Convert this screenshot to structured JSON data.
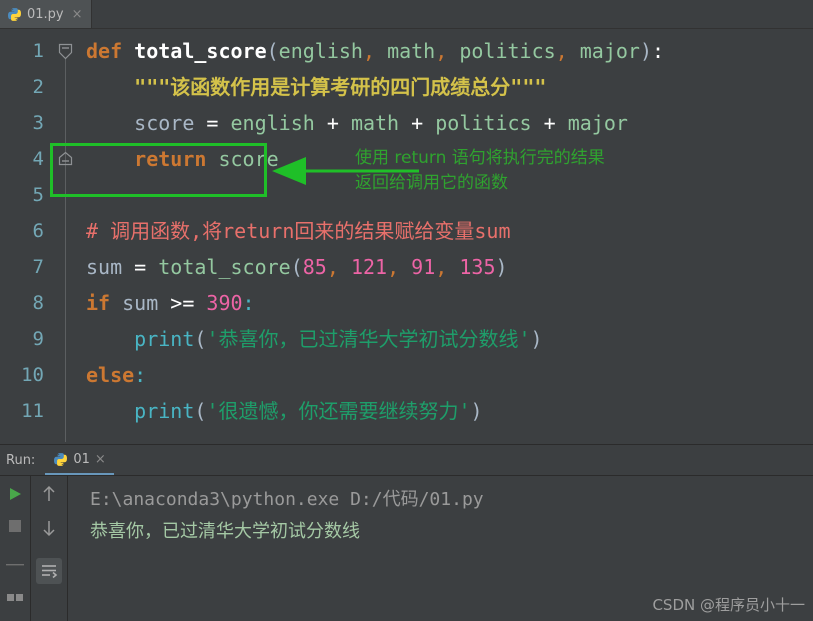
{
  "editor": {
    "tab": {
      "label": "01.py",
      "icon": "python-file-icon",
      "close": "×"
    },
    "line_numbers": [
      "1",
      "2",
      "3",
      "4",
      "5",
      "6",
      "7",
      "8",
      "9",
      "10",
      "11"
    ],
    "lines": [
      {
        "n": 1,
        "tokens": [
          {
            "t": "def ",
            "c": "kw"
          },
          {
            "t": "total_score",
            "c": "fn"
          },
          {
            "t": "(",
            "c": "punct"
          },
          {
            "t": "english",
            "c": "param"
          },
          {
            "t": ", ",
            "c": "comma"
          },
          {
            "t": "math",
            "c": "param"
          },
          {
            "t": ", ",
            "c": "comma"
          },
          {
            "t": "politics",
            "c": "param"
          },
          {
            "t": ", ",
            "c": "comma"
          },
          {
            "t": "major",
            "c": "param"
          },
          {
            "t": ")",
            "c": "punct"
          },
          {
            "t": ":",
            "c": "op"
          }
        ]
      },
      {
        "n": 2,
        "tokens": [
          {
            "t": "    \"\"\"该函数作用是计算考研的四门成绩总分\"\"\"",
            "c": "doc"
          }
        ]
      },
      {
        "n": 3,
        "tokens": [
          {
            "t": "    score ",
            "c": "var"
          },
          {
            "t": "= ",
            "c": "op"
          },
          {
            "t": "english ",
            "c": "param"
          },
          {
            "t": "+ ",
            "c": "op"
          },
          {
            "t": "math ",
            "c": "param"
          },
          {
            "t": "+ ",
            "c": "op"
          },
          {
            "t": "politics ",
            "c": "param"
          },
          {
            "t": "+ ",
            "c": "op"
          },
          {
            "t": "major",
            "c": "param"
          }
        ]
      },
      {
        "n": 4,
        "tokens": [
          {
            "t": "    ",
            "c": "var"
          },
          {
            "t": "return ",
            "c": "kw"
          },
          {
            "t": "score",
            "c": "param"
          }
        ]
      },
      {
        "n": 5,
        "tokens": []
      },
      {
        "n": 6,
        "tokens": [
          {
            "t": "# 调用函数,将return回来的结果赋给变量sum",
            "c": "comment"
          }
        ]
      },
      {
        "n": 7,
        "tokens": [
          {
            "t": "sum ",
            "c": "var"
          },
          {
            "t": "= ",
            "c": "op"
          },
          {
            "t": "total_score",
            "c": "param"
          },
          {
            "t": "(",
            "c": "punct"
          },
          {
            "t": "85",
            "c": "num"
          },
          {
            "t": ", ",
            "c": "comma"
          },
          {
            "t": "121",
            "c": "num"
          },
          {
            "t": ", ",
            "c": "comma"
          },
          {
            "t": "91",
            "c": "num"
          },
          {
            "t": ", ",
            "c": "comma"
          },
          {
            "t": "135",
            "c": "num"
          },
          {
            "t": ")",
            "c": "punct"
          }
        ]
      },
      {
        "n": 8,
        "tokens": [
          {
            "t": "if ",
            "c": "kw"
          },
          {
            "t": "sum ",
            "c": "var"
          },
          {
            "t": ">= ",
            "c": "op"
          },
          {
            "t": "390",
            "c": "num"
          },
          {
            "t": ":",
            "c": "builtin"
          }
        ]
      },
      {
        "n": 9,
        "tokens": [
          {
            "t": "    ",
            "c": "var"
          },
          {
            "t": "print",
            "c": "builtin"
          },
          {
            "t": "(",
            "c": "punct"
          },
          {
            "t": "'恭喜你，已过清华大学初试分数线'",
            "c": "str"
          },
          {
            "t": ")",
            "c": "punct"
          }
        ]
      },
      {
        "n": 10,
        "tokens": [
          {
            "t": "else",
            "c": "kw"
          },
          {
            "t": ":",
            "c": "builtin"
          }
        ]
      },
      {
        "n": 11,
        "tokens": [
          {
            "t": "    ",
            "c": "var"
          },
          {
            "t": "print",
            "c": "builtin"
          },
          {
            "t": "(",
            "c": "punct"
          },
          {
            "t": "'很遗憾，你还需要继续努力'",
            "c": "str"
          },
          {
            "t": ")",
            "c": "punct"
          }
        ]
      }
    ]
  },
  "annotation": {
    "color": "#1fbf28",
    "highlight_target": "return score",
    "text_line1": "使用 return 语句将执行完的结果",
    "text_line2": "返回给调用它的函数"
  },
  "run_panel": {
    "label": "Run:",
    "tab": {
      "label": "01",
      "icon": "python-icon",
      "close": "×"
    },
    "buttons": {
      "run": "run-button",
      "stop": "stop-button",
      "up": "↑",
      "down": "↓",
      "wrap": "soft-wrap-button"
    },
    "console": {
      "command": "E:\\anaconda3\\python.exe D:/代码/01.py",
      "output": "恭喜你，已过清华大学初试分数线"
    }
  },
  "watermark": "CSDN @程序员小十一"
}
